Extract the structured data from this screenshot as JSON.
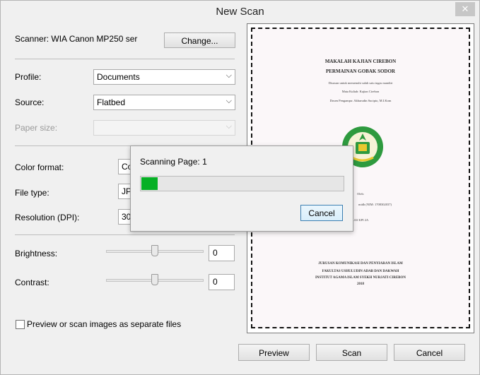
{
  "window": {
    "title": "New Scan",
    "close_glyph": "✕"
  },
  "scanner": {
    "label": "Scanner: WIA Canon MP250 ser",
    "change_button": "Change..."
  },
  "profile": {
    "label": "Profile:",
    "value": "Documents"
  },
  "source": {
    "label": "Source:",
    "value": "Flatbed"
  },
  "paper_size": {
    "label": "Paper size:",
    "value": ""
  },
  "color_format": {
    "label": "Color format:",
    "value": "Co"
  },
  "file_type": {
    "label": "File type:",
    "value": "JP"
  },
  "resolution": {
    "label": "Resolution (DPI):",
    "value": "30"
  },
  "brightness": {
    "label": "Brightness:",
    "value": "0",
    "level": 0
  },
  "contrast": {
    "label": "Contrast:",
    "value": "0",
    "level": 0
  },
  "separate_files": {
    "label": "Preview or scan images as separate files",
    "checked": false
  },
  "buttons": {
    "preview": "Preview",
    "scan": "Scan",
    "cancel": "Cancel"
  },
  "dialog": {
    "status": "Scanning Page: 1",
    "progress_percent": 8,
    "cancel": "Cancel"
  },
  "document_preview": {
    "title1": "MAKALAH KAJIAN CIREBON",
    "title2": "PERMAINAN GOBAK SODOR",
    "line1": "Disusun untuk memenuhi salah satu tugas mandiri",
    "line2": "Mata Kuliah: Kajian Cirebon",
    "line3": "Dosen Pengampu: Akbarudin Sucipto, M.I.Kom",
    "oleh": "Oleh:",
    "nim": "midh (NIM: 1708302037)",
    "kelas": "ELAS KPI 2A",
    "footer1": "JURUSAN KOMUNIKASI DAN PENYIARAN ISLAM",
    "footer2": "FAKULTAS USHULUDIN ADAB DAN DAKWAH",
    "footer3": "INSTITUT AGAMA ISLAM SYEKH NURJATI CIREBON",
    "year": "2018"
  },
  "colors": {
    "progress": "#06b025",
    "logo_green": "#2e9a3f"
  },
  "icons": {
    "dropdown": "chevron-down-icon",
    "close": "close-icon"
  }
}
